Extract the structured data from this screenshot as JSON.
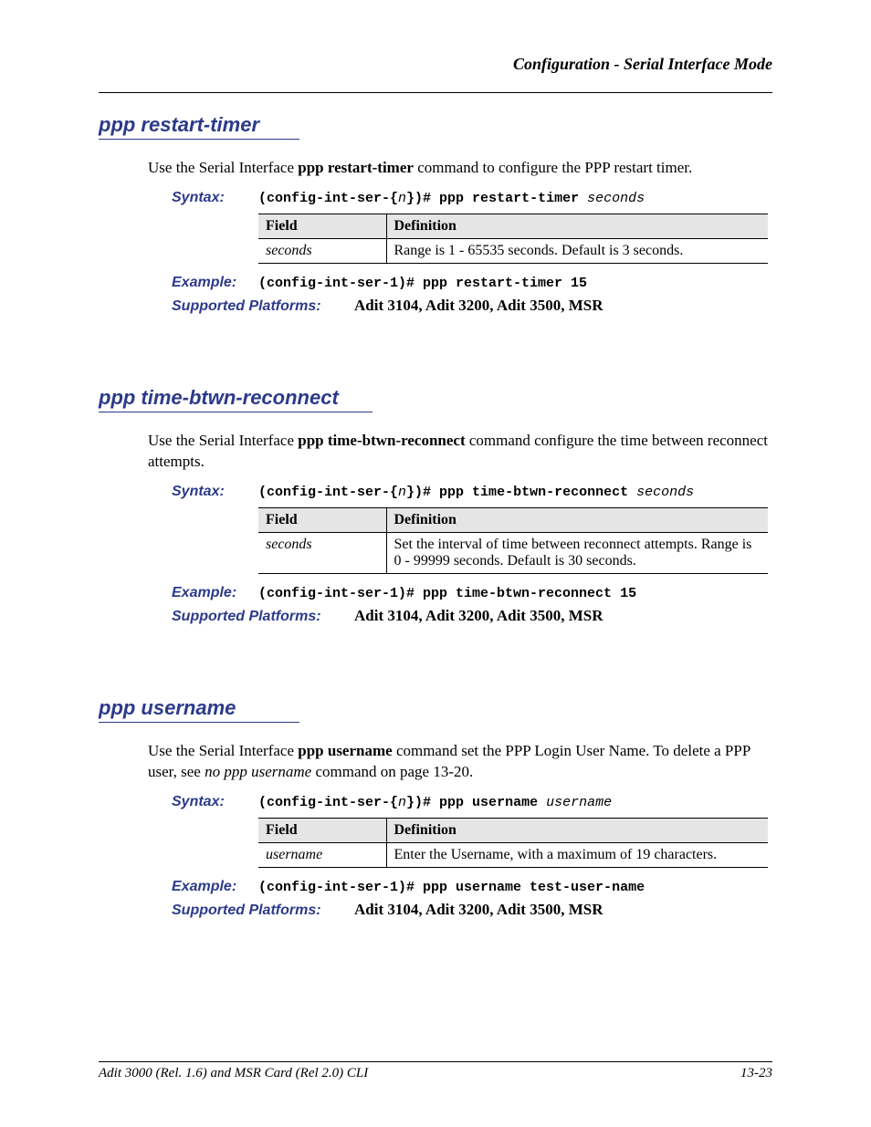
{
  "header": "Configuration - Serial Interface Mode",
  "sections": [
    {
      "title": "ppp restart-timer",
      "desc_pre": "Use the Serial Interface ",
      "desc_bold": "ppp restart-timer",
      "desc_post": " command to configure the PPP restart timer.",
      "syntax_label": "Syntax:",
      "syntax_prefix": "(config-int-ser-{",
      "syntax_n": "n",
      "syntax_mid": "})# ppp restart-timer ",
      "syntax_arg": "seconds",
      "table": {
        "h1": "Field",
        "h2": "Definition",
        "f1": "seconds",
        "d1": "Range is 1 - 65535 seconds. Default is 3 seconds."
      },
      "example_label": "Example:",
      "example_text": "(config-int-ser-1)# ppp restart-timer 15",
      "platforms_label": "Supported Platforms:",
      "platforms_text": "Adit 3104, Adit 3200, Adit 3500, MSR"
    },
    {
      "title": "ppp time-btwn-reconnect",
      "desc_pre": "Use the Serial Interface ",
      "desc_bold": "ppp time-btwn-reconnect",
      "desc_post": " command configure the time between reconnect attempts.",
      "syntax_label": "Syntax:",
      "syntax_prefix": "(config-int-ser-{",
      "syntax_n": "n",
      "syntax_mid": "})# ppp time-btwn-reconnect ",
      "syntax_arg": "seconds",
      "table": {
        "h1": "Field",
        "h2": "Definition",
        "f1": "seconds",
        "d1": "Set the interval of time between reconnect attempts. Range is 0 - 99999 seconds. Default is 30 seconds."
      },
      "example_label": "Example:",
      "example_text": "(config-int-ser-1)# ppp time-btwn-reconnect 15",
      "platforms_label": "Supported Platforms:",
      "platforms_text": "Adit 3104, Adit 3200, Adit 3500, MSR"
    },
    {
      "title": "ppp username",
      "desc_pre": "Use the Serial Interface ",
      "desc_bold": "ppp username",
      "desc_post": " command set the PPP Login User Name. To delete a PPP user, see ",
      "desc_ital": "no ppp username",
      "desc_post2": " command on page 13-20.",
      "syntax_label": "Syntax:",
      "syntax_prefix": "(config-int-ser-{",
      "syntax_n": "n",
      "syntax_mid": "})# ppp username ",
      "syntax_arg": "username",
      "table": {
        "h1": "Field",
        "h2": "Definition",
        "f1": "username",
        "d1": "Enter the Username, with a maximum of 19 characters."
      },
      "example_label": "Example:",
      "example_text": "(config-int-ser-1)# ppp username test-user-name",
      "platforms_label": "Supported Platforms:",
      "platforms_text": "Adit 3104, Adit 3200, Adit 3500, MSR"
    }
  ],
  "footer": {
    "left": "Adit 3000 (Rel. 1.6) and MSR Card (Rel 2.0) CLI",
    "right": "13-23"
  }
}
